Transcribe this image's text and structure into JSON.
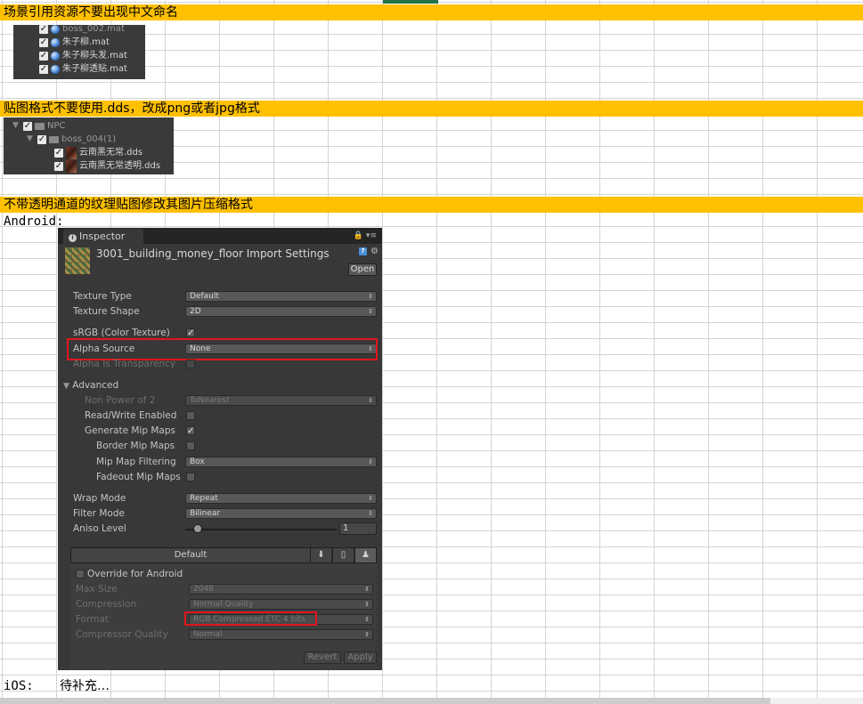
{
  "section1": {
    "header": "场景引用资源不要出现中文命名",
    "files": [
      {
        "name": "boss_002.mat"
      },
      {
        "name": "朱子柳.mat"
      },
      {
        "name": "朱子柳头发.mat"
      },
      {
        "name": "朱子柳透贴.mat"
      }
    ]
  },
  "section2": {
    "header": "贴图格式不要使用.dds，改成png或者jpg格式",
    "tree": {
      "root": "NPC",
      "folder": "boss_004(1)",
      "files": [
        "云南黑无常.dds",
        "云南黑无常透明.dds"
      ]
    }
  },
  "section3": {
    "header": "不带透明通道的纹理贴图修改其图片压缩格式",
    "android_label": "Android:",
    "ios_label": "iOS:",
    "ios_note": "待补充…"
  },
  "inspector": {
    "tab": "Inspector",
    "title": "3001_building_money_floor Import Settings",
    "open_button": "Open",
    "texture_type": {
      "label": "Texture Type",
      "value": "Default"
    },
    "texture_shape": {
      "label": "Texture Shape",
      "value": "2D"
    },
    "srgb": {
      "label": "sRGB (Color Texture)",
      "checked": true
    },
    "alpha_source": {
      "label": "Alpha Source",
      "value": "None"
    },
    "alpha_transparency": {
      "label": "Alpha Is Transparency",
      "checked": false
    },
    "advanced": {
      "label": "Advanced",
      "npot": {
        "label": "Non Power of 2",
        "value": "ToNearest"
      },
      "read_write": {
        "label": "Read/Write Enabled",
        "checked": false
      },
      "gen_mip": {
        "label": "Generate Mip Maps",
        "checked": true
      },
      "border_mip": {
        "label": "Border Mip Maps",
        "checked": false
      },
      "mip_filter": {
        "label": "Mip Map Filtering",
        "value": "Box"
      },
      "fadeout": {
        "label": "Fadeout Mip Maps",
        "checked": false
      }
    },
    "wrap_mode": {
      "label": "Wrap Mode",
      "value": "Repeat"
    },
    "filter_mode": {
      "label": "Filter Mode",
      "value": "Bilinear"
    },
    "aniso": {
      "label": "Aniso Level",
      "value": "1"
    },
    "platform": {
      "default_tab": "Default",
      "override": {
        "label": "Override for Android",
        "checked": false
      },
      "max_size": {
        "label": "Max Size",
        "value": "2048"
      },
      "compression": {
        "label": "Compression",
        "value": "Normal Quality"
      },
      "format": {
        "label": "Format",
        "value": "RGB Compressed ETC 4 bits"
      },
      "compressor_quality": {
        "label": "Compressor Quality",
        "value": "Normal"
      }
    },
    "revert_button": "Revert",
    "apply_button": "Apply"
  },
  "colors": {
    "header_bg": "#ffc000",
    "highlight": "#e0161b",
    "panel": "#383838"
  }
}
